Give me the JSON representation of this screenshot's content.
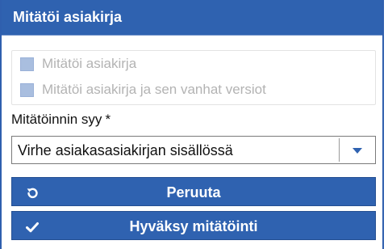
{
  "dialog": {
    "title": "Mitätöi asiakirja"
  },
  "options": [
    {
      "label": "Mitätöi asiakirja",
      "checked": false,
      "disabled": true
    },
    {
      "label": "Mitätöi asiakirja ja sen vanhat versiot",
      "checked": false,
      "disabled": true
    }
  ],
  "reason": {
    "label": "Mitätöinnin syy",
    "required_mark": "*",
    "selected_value": "Virhe asiakasasiakirjan sisällössä"
  },
  "buttons": {
    "cancel_label": "Peruuta",
    "cancel_icon": "undo-icon",
    "confirm_label": "Hyväksy mitätöinti",
    "confirm_icon": "check-icon"
  },
  "colors": {
    "accent": "#2f62b0",
    "checkbox_disabled": "#a9bedf",
    "disabled_text": "#b3b3b3"
  }
}
